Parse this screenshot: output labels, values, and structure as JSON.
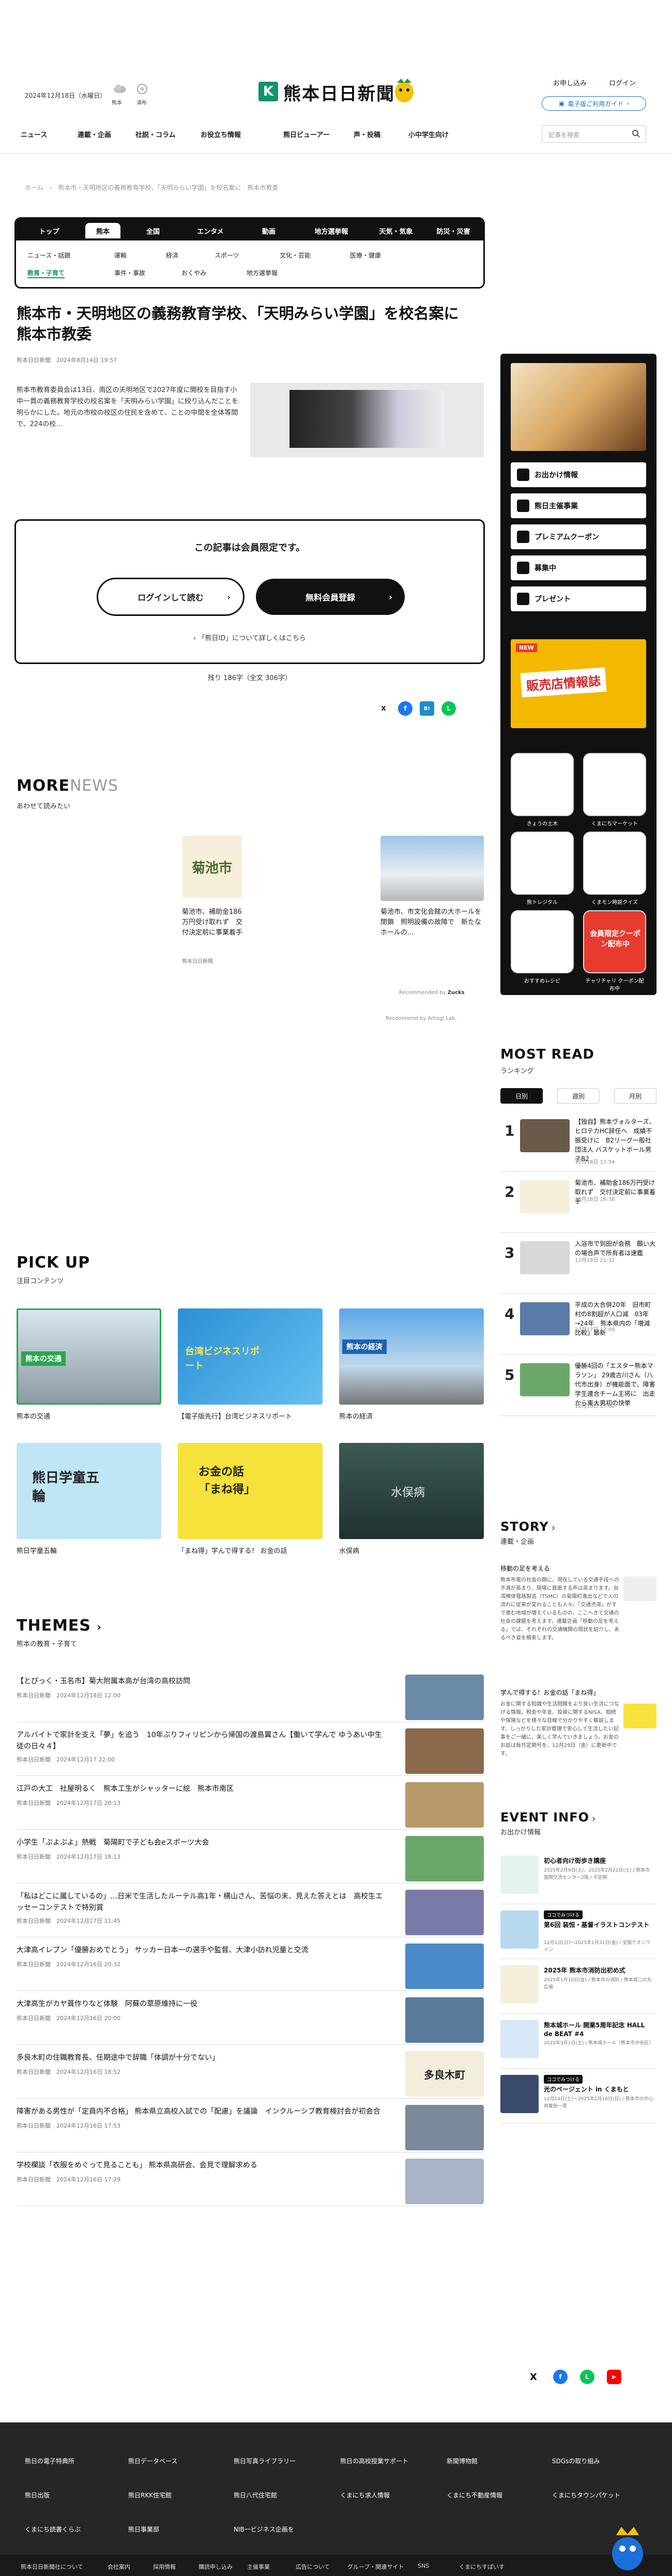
{
  "header": {
    "date": "2024年12月18日（水曜日）",
    "weather": [
      {
        "place": "熊本"
      },
      {
        "place": "湯布"
      }
    ],
    "logo_text": "熊本日日新聞",
    "links": [
      "お申し込み",
      "ログイン"
    ],
    "ebutton": "電子版ご利用ガイド",
    "nav": [
      "ニュース",
      "連載・企画",
      "社説・コラム",
      "お役立ち情報",
      "熊日ビューアー",
      "声・投稿",
      "小中学生向け"
    ],
    "search_placeholder": "記事を検索"
  },
  "breadcrumb": "ホーム　›　熊本市・天明地区の義務教育学校、「天明みらい学園」を校名案に　熊本市教委",
  "cat_tabs": [
    "トップ",
    "熊本",
    "全国",
    "エンタメ",
    "動画",
    "地方選挙報",
    "天気・気象",
    "防災・災害"
  ],
  "sub_row1": [
    "ニュース・話題",
    "運輸",
    "経済",
    "スポーツ",
    "文化・芸能",
    "医療・健康"
  ],
  "sub_row2": [
    "教育・子育て",
    "事件・事故",
    "おくやみ",
    "地方選挙報"
  ],
  "article": {
    "title": "熊本市・天明地区の義務教育学校、「天明みらい学園」を校名案に　熊本市教委",
    "meta": "熊本日日新聞　2024年8月14日 19:57",
    "lead": "熊本市教育委員会は13日、南区の天明地区で2027年度に開校を目指す小中一貫の義務教育学校の校名案を「天明みらい学園」に絞り込んだことを明らかにした。地元の市校の校区の住民を含めて、ことの中間を全体等間で、224の校...",
    "members_title": "この記事は会員限定です。",
    "login": "ログインして読む",
    "register": "無料会員登録",
    "about": "「熊日ID」について詳しくはこちら",
    "remain": "残り 186字（全文 306字）",
    "shares": [
      "X",
      "f",
      "B!",
      "L"
    ]
  },
  "more_news": {
    "head_a": "MORE",
    "head_b": "NEWS",
    "sub": "あわせて読みたい",
    "items": [
      {
        "title": "菊池市、補助金186万円受け取れず　交付決定前に事業着手",
        "src": "熊本日日新聞",
        "img_text": "菊池市"
      },
      {
        "title": "菊池市、市文化会館の大ホールを閉鎖　照明設備の故障で　新たなホールの...",
        "src": "熊本日日新聞"
      }
    ],
    "rec1": "Recommended by",
    "rec1b": "Zucks",
    "rec2": "Recommend by Artisgl Lab."
  },
  "pickup": {
    "head": "PICK UP",
    "sub": "注目コンテンツ",
    "items": [
      {
        "label": "熊本の交通",
        "badge": "熊本の交通"
      },
      {
        "label": "【電子版先行】台湾ビジネスリポート",
        "badge": "台湾ビジネスリポート"
      },
      {
        "label": "熊本の経済",
        "badge": "熊本の経済"
      },
      {
        "label": "熊日学童五輪",
        "badge": "熊日学童五輪"
      },
      {
        "label": "「まね得」学んで得する！ お金の話",
        "badge": "お金の話「まね得」"
      },
      {
        "label": "水俣病",
        "badge": "水俣病"
      }
    ]
  },
  "themes": {
    "head": "THEMES",
    "sub": "熊本の教育・子育て",
    "items": [
      {
        "t": "【とぴっく・玉名市】菊大附属本高が台湾の高校訪問",
        "d": "熊本日日新聞　2024年12月18日 12:00"
      },
      {
        "t": "アルバイトで家計を支え「夢」を追う　10年ぶりフィリピンから帰国の渡島翼さん【働いて学んで ゆうあい中生徒の日々４】",
        "d": "熊本日日新聞　2024年12月17 22:00"
      },
      {
        "t": "江戸の大工　社屋明るく　熊本工生がシャッターに絵　熊本市南区",
        "d": "熊本日日新聞　2024年12月17日 20:13"
      },
      {
        "t": "小学生「ぷよぷよ」熱戦　菊陽町で子ども会eスポーツ大会",
        "d": "熊本日日新聞　2024年12月17日 18:13"
      },
      {
        "t": "「私はどこに属しているの」…日米で生活したルーテル高1年・横山さん、苦悩の末、見えた答えとは　高校生エッセーコンテストで特別賞",
        "d": "熊本日日新聞　2024年12月17日 11:45"
      },
      {
        "t": "大津高イレブン「優勝おめでとう」 サッカー日本一の選手や監督、大津小訪れ児童と交流",
        "d": "熊本日日新聞　2024年12月16日 20:32"
      },
      {
        "t": "大津高生がカヤ葺作りなど体験　阿蘇の草原維持に一役",
        "d": "熊本日日新聞　2024年12月16日 20:00"
      },
      {
        "t": "多良木町の住職教育長、任期途中で辞職「体調が十分でない」",
        "d": "熊本日日新聞　2024年12月16日 18:52",
        "img_text": "多良木町"
      },
      {
        "t": "障害がある男性が「定員内不合格」 熊本県立高校入試での「配慮」を議論　インクルーシブ教育検討会が初会合",
        "d": "熊本日日新聞　2024年12月16日 17:53"
      },
      {
        "t": "学校欄談「衣服をめぐって見ることも」 熊本県高研会、会見で理解求める",
        "d": "熊本日日新聞　2024年12月16日 17:29"
      }
    ]
  },
  "side": {
    "buttons": [
      "お出かけ情報",
      "熊日主催事業",
      "プレミアムクーポン",
      "募集中",
      "プレゼント"
    ],
    "hunt_text": "販売店情報誌",
    "hunt_tag": "NEW",
    "apps": [
      {
        "label": "きょうの土木"
      },
      {
        "label": "くまにちマーケット"
      },
      {
        "label": "熊トレジタル"
      },
      {
        "label": "くまモン時説クイズ"
      },
      {
        "label": "おすすめレシピ"
      },
      {
        "label": "チャリチャリ クーポン配布中"
      }
    ],
    "coupon_text": "会員限定クーポン配布中"
  },
  "ranking": {
    "head": "MOST READ",
    "sub": "ランキング",
    "tabs": [
      "日別",
      "週別",
      "月別"
    ],
    "items": [
      {
        "n": "1",
        "t": "【独自】熊本ヴォルターズ、ヒロテカHC辞任へ　成績不振受けに　B2リーグ一般社団法人 バスケットボール男子B2",
        "d": "12月18日 17:54"
      },
      {
        "n": "2",
        "t": "菊池市、補助金186万円受け取れず　交付決定前に事業着手",
        "d": "12月18日 16:38"
      },
      {
        "n": "3",
        "t": "入浴市で到田が会務　願い大の場合声で所有者は速鑑",
        "d": "12月18日 21:32"
      },
      {
        "n": "4",
        "t": "平成の大合併20年　旧市町村の8割超が人口減　03年→24年　熊本県内の「増減比較」最新",
        "d": "12月17日 17:00"
      },
      {
        "n": "5",
        "t": "優勝4回の「エスター熊本マラソン」 29歳古川さん（八代市出身）が機能面で、障害学生連合チーム主将に　出走から東大男初の快挙",
        "d": "12月16日 17:00"
      }
    ]
  },
  "story": {
    "head": "STORY",
    "sub": "連載・企画",
    "items": [
      {
        "t": "移動の足を考える",
        "x": "熊本市電の社会の顔に。現在している交通手段への不満が高まり、現場に直面する声は高まります。台湾積体電路製造（TSMC）の菊陽町進出などで人の流れに従来が変わることも人々。「交通渋滞」がすで進む地域が増えているものの、ここへきて交通の社会の課題を考えます。連載企画「移動の足を考える」では、それぞれの交通機関の現状を紹介し、あるべき姿を模索します。"
      },
      {
        "t": "学んで得する！お金の話「まね得」",
        "x": "お金に関する知識や生活問題をより良い生活につなげる情報。税金や年金、投資に関するNISA、相続や保険などを様々な目線で分かりやすく解説します。しっかりした家計管理で安心して生活したい記事をご一緒に。楽しく学んでいきましょう。お金のお話は毎月定期号を、12月29日（金）に更新中です。"
      }
    ]
  },
  "event": {
    "head": "EVENT INFO",
    "sub": "お出かけ情報",
    "items": [
      {
        "tag": "",
        "t": "初心者向け街歩き講座",
        "d": "2025年2月9日(土)、2025年2月22日(土) / 熊本市国際交流センター2階 / 不定期"
      },
      {
        "tag": "ココでみつける",
        "t": "第6回 装恒・基督イラストコンテスト",
        "d": "12月1日(日)～2025年1月31日(金) / 全国でオンライン"
      },
      {
        "tag": "",
        "t": "2025年 熊本市消防出初め式",
        "d": "2025年1月10日(金) / 熊本市の消防 / 熊本城二の丸広場"
      },
      {
        "tag": "",
        "t": "熊本城ホール 開業5周年記念 HALL de BEAT #4",
        "d": "2025年3月1日(土) / 熊本城ホール（熊本市中央区）"
      },
      {
        "tag": "ココでみつける",
        "t": "光のページェント in くまもと",
        "d": "12月14日(土)～2025年2月16日(日) / 熊本市の中心商業街一帯"
      }
    ]
  },
  "social": [
    "X",
    "f",
    "L",
    "▶"
  ],
  "footer": {
    "links": [
      "熊日の電子特典所",
      "熊日データベース",
      "熊日写真ライブラリー",
      "熊日の高校授業サポート",
      "新聞博物館",
      "SDGsの取り組み",
      "熊日出版",
      "熊日RKK住宅館",
      "熊日八代住宅館",
      "くまにち求人情報",
      "くまにち不動産情報",
      "くまにちタウンパケット",
      "くまにち読書くらぶ",
      "熊日事業部",
      "NIB一ビジネス企画を"
    ],
    "bottom": [
      "熊本日日新聞社について",
      "会社案内",
      "採用情報",
      "購読申し込み",
      "主催事業",
      "広告について",
      "グループ・関連サイト",
      "SNS",
      "くまにちすぱいす"
    ]
  }
}
